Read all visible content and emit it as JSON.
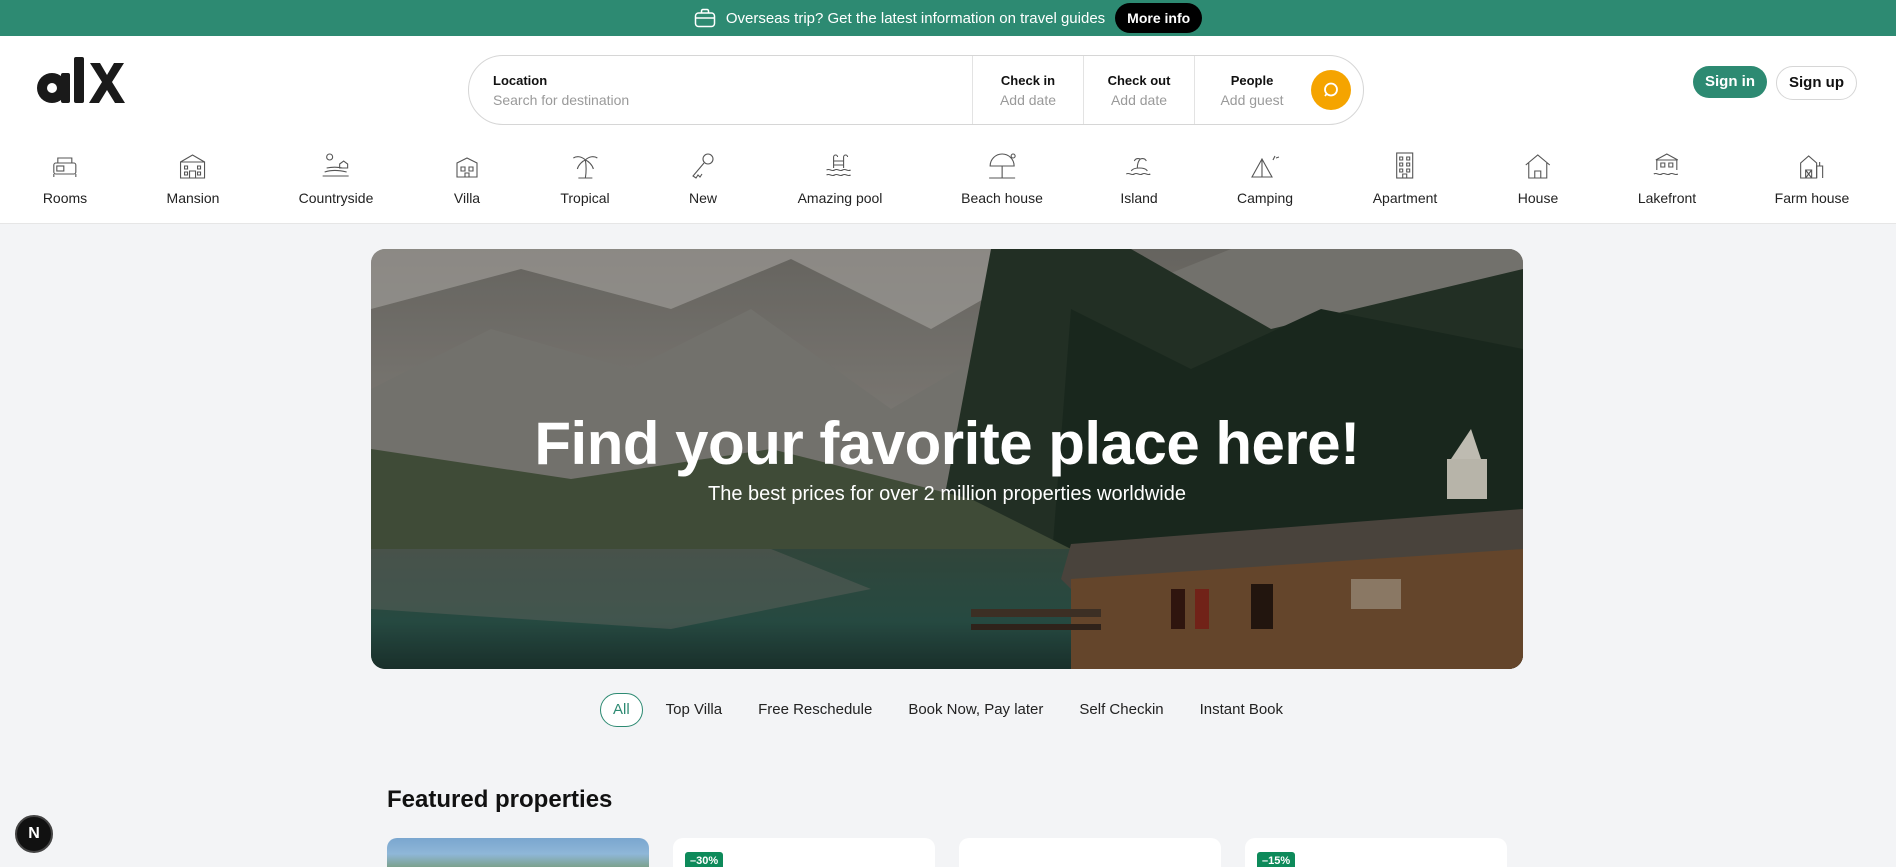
{
  "banner": {
    "icon": "briefcase-icon",
    "text": "Overseas trip? Get the latest information on travel guides",
    "button": "More info"
  },
  "header": {
    "logo": "alx",
    "search": {
      "location_label": "Location",
      "location_placeholder": "Search for destination",
      "checkin_label": "Check in",
      "checkin_placeholder": "Add date",
      "checkout_label": "Check out",
      "checkout_placeholder": "Add date",
      "people_label": "People",
      "people_placeholder": "Add guest",
      "search_icon": "search-icon"
    },
    "signin": "Sign in",
    "signup": "Sign up"
  },
  "categories": [
    {
      "label": "Rooms",
      "icon": "room-icon"
    },
    {
      "label": "Mansion",
      "icon": "mansion-icon"
    },
    {
      "label": "Countryside",
      "icon": "countryside-icon"
    },
    {
      "label": "Villa",
      "icon": "villa-icon"
    },
    {
      "label": "Tropical",
      "icon": "palm-tree-icon"
    },
    {
      "label": "New",
      "icon": "key-icon"
    },
    {
      "label": "Amazing pool",
      "icon": "pool-icon"
    },
    {
      "label": "Beach house",
      "icon": "beach-icon"
    },
    {
      "label": "Island",
      "icon": "island-icon"
    },
    {
      "label": "Camping",
      "icon": "tent-icon"
    },
    {
      "label": "Apartment",
      "icon": "apartment-icon"
    },
    {
      "label": "House",
      "icon": "house-icon"
    },
    {
      "label": "Lakefront",
      "icon": "lakefront-icon"
    },
    {
      "label": "Farm house",
      "icon": "farm-house-icon"
    }
  ],
  "hero": {
    "title": "Find your favorite place here!",
    "subtitle": "The best prices for over 2 million properties worldwide"
  },
  "filters": [
    "All",
    "Top Villa",
    "Free Reschedule",
    "Book Now, Pay later",
    "Self Checkin",
    "Instant Book"
  ],
  "featured": {
    "title": "Featured properties",
    "cards": [
      {
        "badge": ""
      },
      {
        "badge": "–30%"
      },
      {
        "badge": ""
      },
      {
        "badge": "–15%"
      }
    ]
  },
  "dev_button": "N",
  "colors": {
    "brand": "#2d8a72",
    "search_button": "#f5a400",
    "discount_badge": "#0d8a5a"
  }
}
